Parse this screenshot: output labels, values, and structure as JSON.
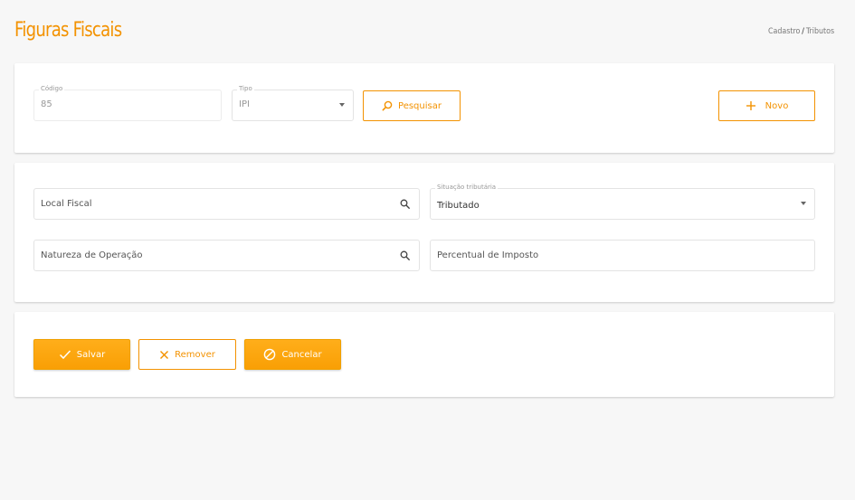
{
  "header": {
    "title": "Figuras Fiscais",
    "breadcrumb": {
      "parent": "Cadastro",
      "separator": "/",
      "current": "Tributos"
    }
  },
  "search_card": {
    "codigo": {
      "label": "Código",
      "value": "85"
    },
    "tipo": {
      "label": "Tipo",
      "value": "IPI"
    },
    "pesquisar_label": "Pesquisar",
    "novo_label": "Novo"
  },
  "form_card": {
    "local_fiscal": {
      "placeholder": "Local Fiscal"
    },
    "situacao": {
      "label": "Situação tributária",
      "value": "Tributado"
    },
    "natureza": {
      "placeholder": "Natureza de Operação"
    },
    "percentual": {
      "placeholder": "Percentual de Imposto"
    }
  },
  "actions": {
    "salvar_label": "Salvar",
    "remover_label": "Remover",
    "cancelar_label": "Cancelar"
  },
  "colors": {
    "accent": "#f39200",
    "accent_solid": "#ffa80d",
    "background": "#f7f7f7"
  },
  "icons": [
    "search-icon",
    "check-icon",
    "close-icon",
    "cancel-icon",
    "plus-icon",
    "chevron-down-icon"
  ]
}
